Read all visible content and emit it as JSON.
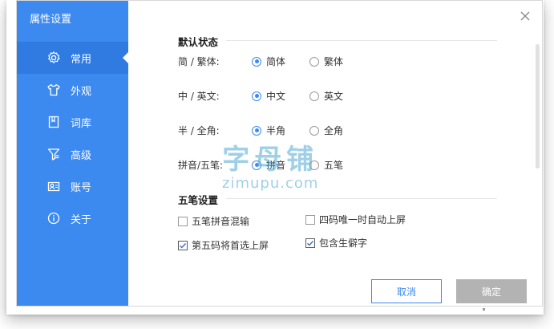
{
  "window": {
    "title": "属性设置"
  },
  "sidebar": {
    "items": [
      {
        "label": "常用",
        "icon": "gear-icon",
        "active": true
      },
      {
        "label": "外观",
        "icon": "shirt-icon",
        "active": false
      },
      {
        "label": "词库",
        "icon": "book-icon",
        "active": false
      },
      {
        "label": "高级",
        "icon": "funnel-icon",
        "active": false
      },
      {
        "label": "账号",
        "icon": "account-icon",
        "active": false
      },
      {
        "label": "关于",
        "icon": "info-icon",
        "active": false
      }
    ]
  },
  "default_state": {
    "title": "默认状态",
    "rows": [
      {
        "label": "简 / 繁体:",
        "options": [
          "简体",
          "繁体"
        ],
        "selected": "简体"
      },
      {
        "label": "中 / 英文:",
        "options": [
          "中文",
          "英文"
        ],
        "selected": "中文"
      },
      {
        "label": "半 / 全角:",
        "options": [
          "半角",
          "全角"
        ],
        "selected": "半角"
      },
      {
        "label": "拼音/五笔:",
        "options": [
          "拼音",
          "五笔"
        ],
        "selected": "拼音"
      }
    ]
  },
  "wubi": {
    "title": "五笔设置",
    "options": [
      {
        "label": "五笔拼音混输",
        "checked": false
      },
      {
        "label": "四码唯一时自动上屏",
        "checked": false
      },
      {
        "label": "第五码将首选上屏",
        "checked": true
      },
      {
        "label": "包含生僻字",
        "checked": true
      }
    ]
  },
  "buttons": {
    "cancel": "取消",
    "ok": "确定"
  },
  "watermark": {
    "big": "字母铺",
    "small": "zimupu.com"
  },
  "colors": {
    "accent": "#3c8af0",
    "sidebar_bg": "#3c8af0",
    "active_item": "#2f7be2",
    "disabled_button": "#b3b3b3"
  }
}
